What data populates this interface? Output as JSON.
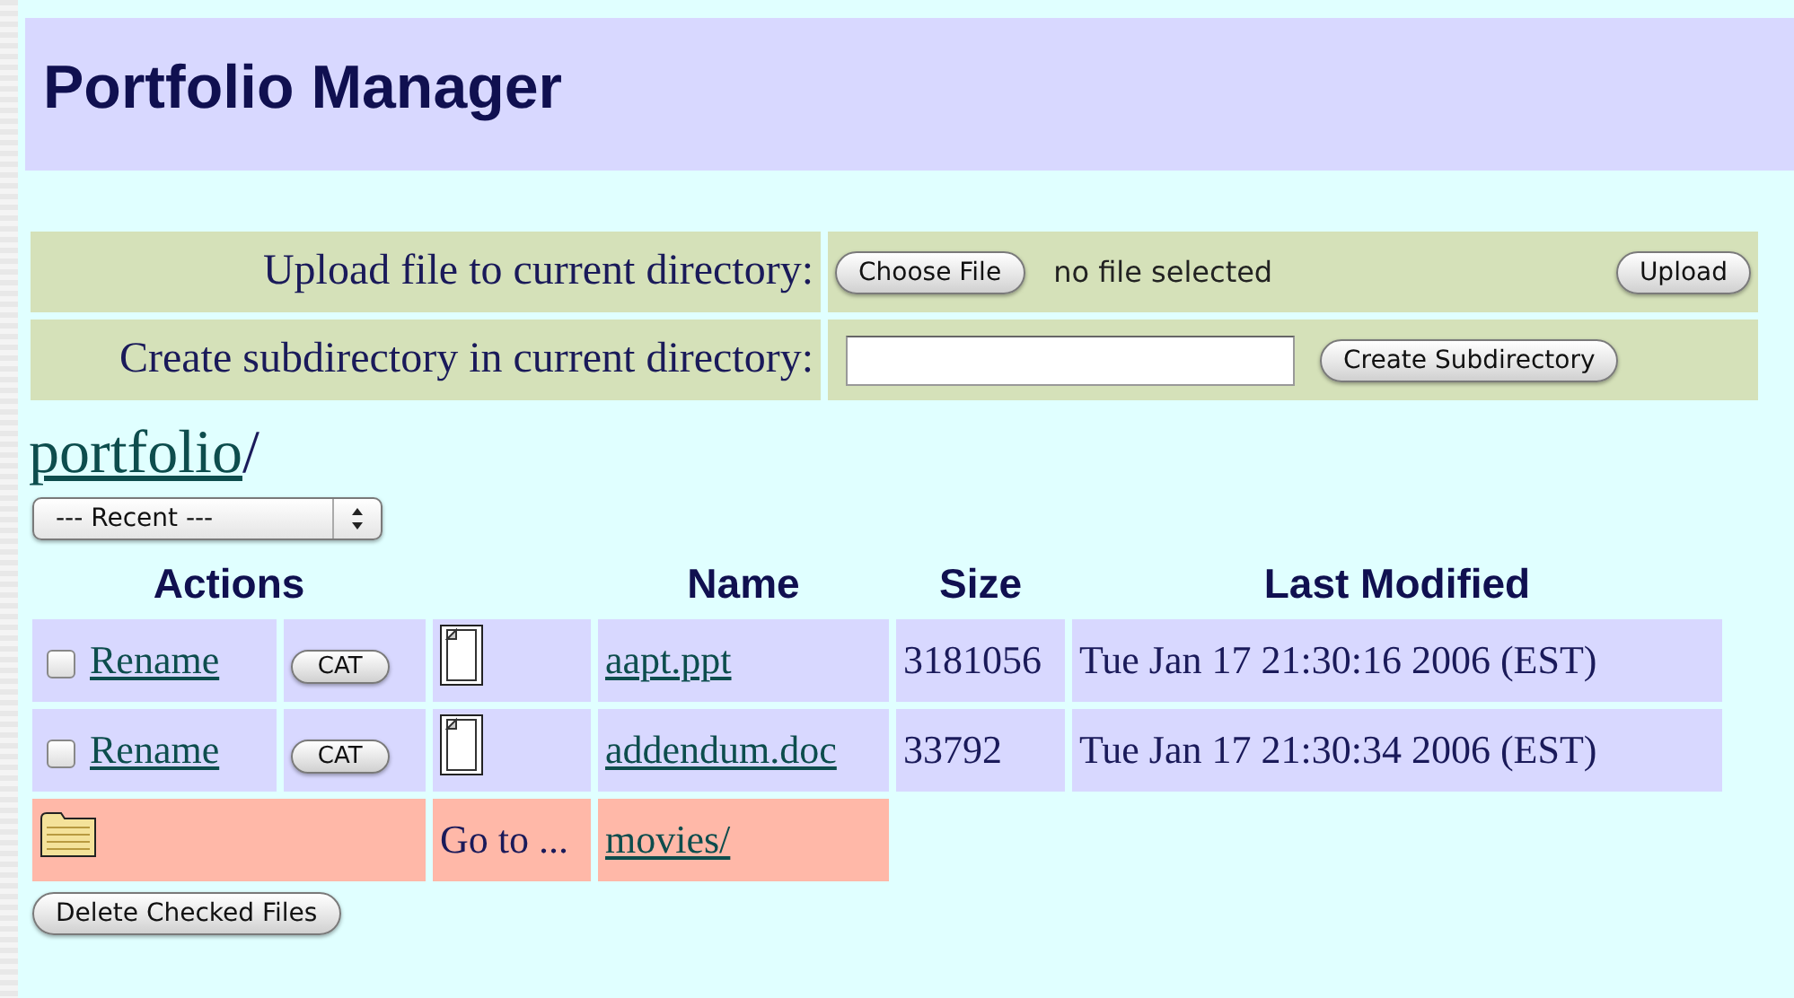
{
  "title": "Portfolio Manager",
  "upload": {
    "label": "Upload file to current directory:",
    "choose_button": "Choose File",
    "file_status": "no file selected",
    "upload_button": "Upload"
  },
  "subdirectory": {
    "label": "Create subdirectory in current directory:",
    "create_button": "Create Subdirectory"
  },
  "path": {
    "link": "portfolio",
    "separator": "/"
  },
  "recent_select": {
    "value": "--- Recent ---"
  },
  "table": {
    "headers": {
      "actions": "Actions",
      "name": "Name",
      "size": "Size",
      "last_modified": "Last Modified"
    },
    "rows": [
      {
        "kind": "file",
        "checked": false,
        "rename": "Rename",
        "cat": "CAT",
        "name": "aapt.ppt",
        "size": "3181056",
        "modified": "Tue Jan 17 21:30:16 2006 (EST)"
      },
      {
        "kind": "file",
        "checked": false,
        "rename": "Rename",
        "cat": "CAT",
        "name": "addendum.doc",
        "size": "33792",
        "modified": "Tue Jan 17 21:30:34 2006 (EST)"
      },
      {
        "kind": "folder",
        "goto": "Go to ...",
        "name": "movies/"
      }
    ]
  },
  "delete_button": "Delete Checked Files"
}
